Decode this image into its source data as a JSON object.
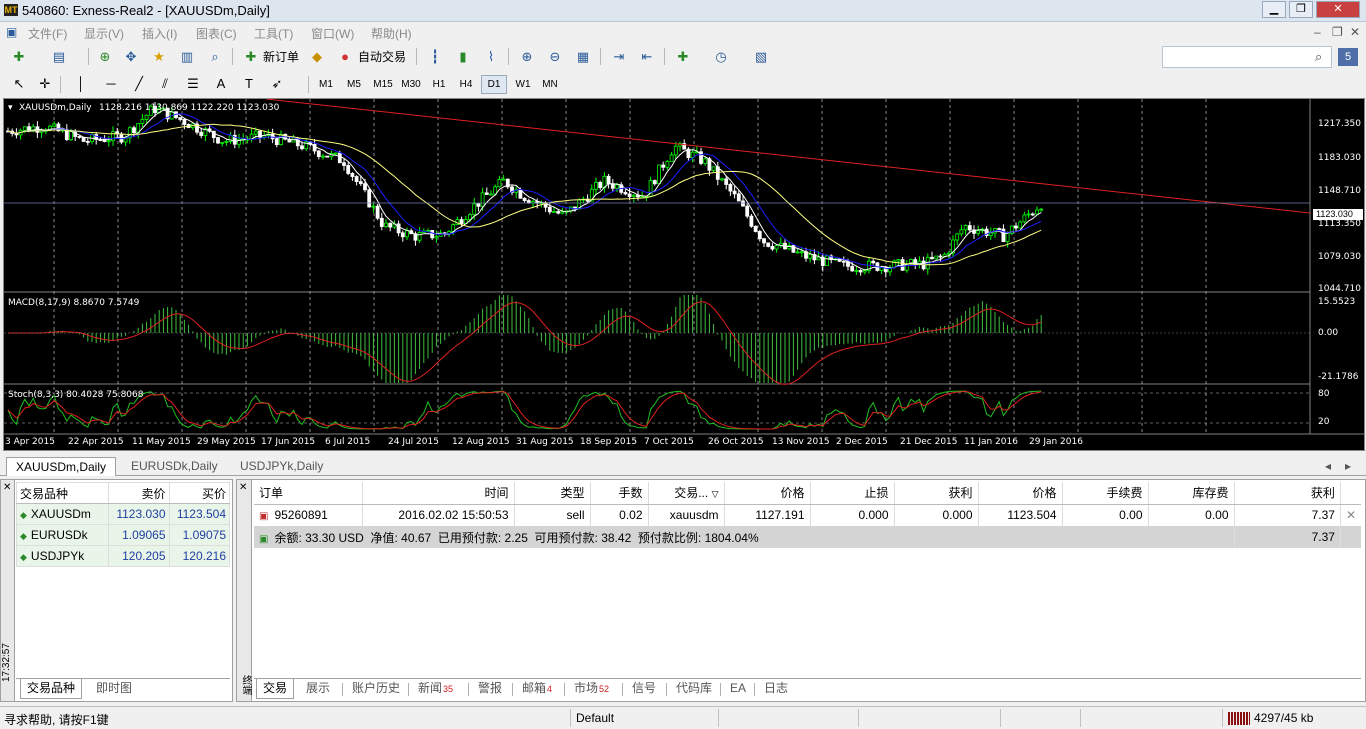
{
  "window": {
    "title": "540860: Exness-Real2 - [XAUUSDm,Daily]",
    "app_icon": "MT",
    "minimize": "▁",
    "maximize": "❐",
    "close": "✕",
    "child_minimize": "–",
    "child_restore": "❐",
    "child_close": "✕"
  },
  "menu": [
    "文件(F)",
    "显示(V)",
    "插入(I)",
    "图表(C)",
    "工具(T)",
    "窗口(W)",
    "帮助(H)"
  ],
  "toolbar": {
    "new_order": "新订单",
    "auto_trade": "自动交易",
    "timeframes": [
      "M1",
      "M5",
      "M15",
      "M30",
      "H1",
      "H4",
      "D1",
      "W1",
      "MN"
    ],
    "selected_timeframe": "D1",
    "search_placeholder": "",
    "mail_count": "5"
  },
  "chart": {
    "symbol_label": "XAUUSDm,Daily",
    "ohlc": "1128.216 1130.869 1122.220 1123.030",
    "price_scale": [
      "1217.350",
      "1183.030",
      "1148.710",
      "1113.350",
      "1079.030",
      "1044.710"
    ],
    "bid_tag": "1123.030",
    "macd_label": "MACD(8,17,9) 8.8670 7.5749",
    "macd_scale": [
      "15.5523",
      "0.00",
      "-21.1786"
    ],
    "stoch_label": "Stoch(8,3,3) 80.4028 75.8068",
    "stoch_scale": [
      "80",
      "20"
    ],
    "dates": [
      "3 Apr 2015",
      "22 Apr 2015",
      "11 May 2015",
      "29 May 2015",
      "17 Jun 2015",
      "6 Jul 2015",
      "24 Jul 2015",
      "12 Aug 2015",
      "31 Aug 2015",
      "18 Sep 2015",
      "7 Oct 2015",
      "26 Oct 2015",
      "13 Nov 2015",
      "2 Dec 2015",
      "21 Dec 2015",
      "11 Jan 2016",
      "29 Jan 2016"
    ],
    "colors": {
      "up": "#00ff00",
      "down": "#ffffff",
      "bg": "#000000",
      "ma_fast": "#ffffff",
      "ma_mid": "#1e1eff",
      "ma_slow": "#ffff80",
      "trend": "#e02020",
      "grid": "#c0c0c0"
    }
  },
  "chart_tabs": [
    "XAUUSDm,Daily",
    "EURUSDk,Daily",
    "USDJPYk,Daily"
  ],
  "market_watch": {
    "headers": [
      "交易品种",
      "卖价",
      "买价"
    ],
    "rows": [
      {
        "symbol": "XAUUSDm",
        "bid": "1123.030",
        "ask": "1123.504"
      },
      {
        "symbol": "EURUSDk",
        "bid": "1.09065",
        "ask": "1.09075"
      },
      {
        "symbol": "USDJPYk",
        "bid": "120.205",
        "ask": "120.216"
      }
    ],
    "time": "17:32:57",
    "tabs": [
      "交易品种",
      "即时图"
    ]
  },
  "terminal": {
    "side_label": "终端",
    "headers": [
      "订单",
      "时间",
      "类型",
      "手数",
      "交易...",
      "价格",
      "止损",
      "获利",
      "价格",
      "手续费",
      "库存费",
      "获利"
    ],
    "order": {
      "id": "95260891",
      "time": "2016.02.02 15:50:53",
      "type": "sell",
      "lots": "0.02",
      "symbol": "xauusdm",
      "open_price": "1127.191",
      "sl": "0.000",
      "tp": "0.000",
      "price": "1123.504",
      "commission": "0.00",
      "swap": "0.00",
      "profit": "7.37"
    },
    "summary": {
      "text": "余额: 33.30 USD  净值: 40.67  已用预付款: 2.25  可用预付款: 38.42  预付款比例: 1804.04%",
      "profit": "7.37"
    },
    "tabs": [
      {
        "label": "交易",
        "badge": ""
      },
      {
        "label": "展示",
        "badge": ""
      },
      {
        "label": "账户历史",
        "badge": ""
      },
      {
        "label": "新闻",
        "badge": "35"
      },
      {
        "label": "警报",
        "badge": ""
      },
      {
        "label": "邮箱",
        "badge": "4"
      },
      {
        "label": "市场",
        "badge": "52"
      },
      {
        "label": "信号",
        "badge": ""
      },
      {
        "label": "代码库",
        "badge": ""
      },
      {
        "label": "EA",
        "badge": ""
      },
      {
        "label": "日志",
        "badge": ""
      }
    ]
  },
  "status": {
    "help": "寻求帮助, 请按F1键",
    "profile": "Default",
    "traffic": "4297/45 kb"
  }
}
